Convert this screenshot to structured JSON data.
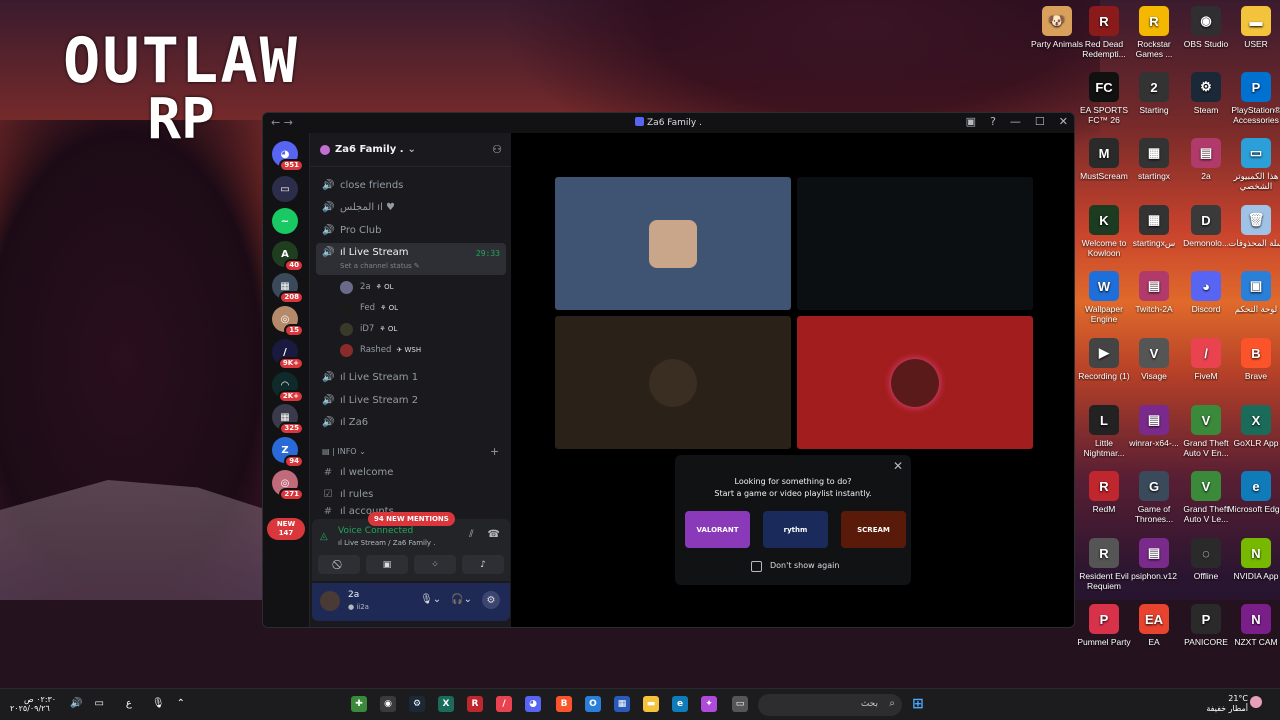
{
  "wallpaper": {
    "logo_line1": "OUTLAW",
    "logo_line2": "RP"
  },
  "desktop_icons": [
    {
      "label": "Party Animals",
      "color": "#d9a05b",
      "glyph": "🐶"
    },
    {
      "label": "Red Dead Redempti...",
      "color": "#8b1b1b",
      "glyph": "R"
    },
    {
      "label": "Rockstar Games ...",
      "color": "#f5b800",
      "glyph": "R"
    },
    {
      "label": "OBS Studio",
      "color": "#302e31",
      "glyph": "◉"
    },
    {
      "label": "USER",
      "color": "#f3c33b",
      "glyph": "▬"
    },
    {
      "label": "EA SPORTS FC™ 26",
      "color": "#111111",
      "glyph": "FC"
    },
    {
      "label": "Starting",
      "color": "#333333",
      "glyph": "2"
    },
    {
      "label": "Steam",
      "color": "#1b2838",
      "glyph": "⚙"
    },
    {
      "label": "PlayStation® Accessories",
      "color": "#0070d1",
      "glyph": "P"
    },
    {
      "label": "MustScream",
      "color": "#2a2a2a",
      "glyph": "M"
    },
    {
      "label": "startingx",
      "color": "#333333",
      "glyph": "▦"
    },
    {
      "label": "2a",
      "color": "#b03a6a",
      "glyph": "▤"
    },
    {
      "label": "هذا الكمبيوتر الشخصي",
      "color": "#2a9fd8",
      "glyph": "▭"
    },
    {
      "label": "Welcome to Kowloon",
      "color": "#1d3b20",
      "glyph": "K"
    },
    {
      "label": "startingxس",
      "color": "#333333",
      "glyph": "▦"
    },
    {
      "label": "Demonolo...",
      "color": "#3a3a3a",
      "glyph": "D"
    },
    {
      "label": "سلة المحذوفات",
      "color": "#9fc3e6",
      "glyph": "🗑"
    },
    {
      "label": "Wallpaper Engine",
      "color": "#1e6fd9",
      "glyph": "W"
    },
    {
      "label": "Twitch-2A",
      "color": "#b03a6a",
      "glyph": "▤"
    },
    {
      "label": "Discord",
      "color": "#5865f2",
      "glyph": "◕"
    },
    {
      "label": "لوحة التحكم",
      "color": "#2a7fd8",
      "glyph": "▣"
    },
    {
      "label": "Recording (1)",
      "color": "#444444",
      "glyph": "▶"
    },
    {
      "label": "Visage",
      "color": "#555555",
      "glyph": "V"
    },
    {
      "label": "FiveM",
      "color": "#e8434f",
      "glyph": "/"
    },
    {
      "label": "Brave",
      "color": "#fb542b",
      "glyph": "B"
    },
    {
      "label": "Little Nightmar...",
      "color": "#222222",
      "glyph": "L"
    },
    {
      "label": "winrar-x64-...",
      "color": "#7a2a8a",
      "glyph": "▤"
    },
    {
      "label": "Grand Theft Auto V En...",
      "color": "#3b8a3b",
      "glyph": "V"
    },
    {
      "label": "GoXLR App",
      "color": "#1a6b5a",
      "glyph": "X"
    },
    {
      "label": "RedM",
      "color": "#c0262d",
      "glyph": "R"
    },
    {
      "label": "Game of Thrones...",
      "color": "#3a4a5a",
      "glyph": "G"
    },
    {
      "label": "Grand Theft Auto V Le...",
      "color": "#3b8a3b",
      "glyph": "V"
    },
    {
      "label": "Microsoft Edge",
      "color": "#0f7bb8",
      "glyph": "e"
    },
    {
      "label": "Resident Evil Requiem",
      "color": "#555555",
      "glyph": "R"
    },
    {
      "label": "psiphon.v12",
      "color": "#7a2a8a",
      "glyph": "▤"
    },
    {
      "label": "Offline",
      "color": "#2a2a2a",
      "glyph": "◌"
    },
    {
      "label": "NVIDIA App",
      "color": "#76b900",
      "glyph": "N"
    },
    {
      "label": "Pummel Party",
      "color": "#d8324a",
      "glyph": "P"
    },
    {
      "label": "EA",
      "color": "#e8432f",
      "glyph": "EA"
    },
    {
      "label": "PANICORE",
      "color": "#2a2a2a",
      "glyph": "P"
    },
    {
      "label": "NZXT CAM",
      "color": "#7a1f8a",
      "glyph": "N"
    }
  ],
  "window": {
    "title": "Za6 Family .",
    "server_name": "Za6 Family ."
  },
  "guilds": [
    {
      "badge": "951",
      "color": "#5865f2",
      "glyph": "◕"
    },
    {
      "badge": "",
      "color": "#2b2d4a",
      "glyph": "▭"
    },
    {
      "badge": "",
      "color": "#18c964",
      "glyph": "~"
    },
    {
      "badge": "40",
      "color": "#1f3d1f",
      "glyph": "A"
    },
    {
      "badge": "208",
      "color": "#3a4a5a",
      "glyph": "▦"
    },
    {
      "badge": "15",
      "color": "#b58a6a",
      "glyph": "◎"
    },
    {
      "badge": "9K+",
      "color": "#1a1a40",
      "glyph": "/"
    },
    {
      "badge": "2K+",
      "color": "#0f2a2a",
      "glyph": "◠"
    },
    {
      "badge": "325",
      "color": "#3a3a4a",
      "glyph": "▦"
    },
    {
      "badge": "94",
      "color": "#2a6ad8",
      "glyph": "Z"
    },
    {
      "badge": "271",
      "color": "#c06a7a",
      "glyph": "◎"
    }
  ],
  "new_pill": {
    "line1": "NEW",
    "line2": "147"
  },
  "channels": [
    {
      "icon": "🔊",
      "name": "close friends"
    },
    {
      "icon": "🔊",
      "name": "المجلس ıl ♥"
    },
    {
      "icon": "🔊",
      "name": "Pro Club"
    }
  ],
  "live_stream": {
    "name": "ıl Live Stream",
    "timer": "29:33",
    "status": "Set a channel status ✎"
  },
  "voice_users": [
    {
      "name": "2a",
      "tag": "OL",
      "color": "#6a6a8a"
    },
    {
      "name": "Fed",
      "tag": "OL",
      "color": "#1a1a1a"
    },
    {
      "name": "iD7",
      "tag": "OL",
      "color": "#3a3a2a"
    },
    {
      "name": "Rashed",
      "tag": "WSH",
      "color": "#8a2a2a"
    }
  ],
  "more_channels": [
    {
      "icon": "🔊",
      "name": "ıl Live Stream 1"
    },
    {
      "icon": "🔊",
      "name": "ıl Live Stream 2"
    },
    {
      "icon": "🔊",
      "name": "ıl Za6"
    }
  ],
  "category": {
    "name": "| INFO ⌄",
    "plus": "+"
  },
  "info_channels": [
    {
      "icon": "#",
      "name": "ıl welcome"
    },
    {
      "icon": "☑",
      "name": "ıl rules"
    },
    {
      "icon": "#",
      "name": "ıl accounts"
    }
  ],
  "mentions_pill": "94 NEW MENTIONS",
  "voice_panel": {
    "title": "Voice Connected",
    "subtitle": "ıl Live Stream / Za6 Family ."
  },
  "user_panel": {
    "name": "2a",
    "status": "ii2a"
  },
  "popup": {
    "line1": "Looking for something to do?",
    "line2": "Start a game or video playlist instantly.",
    "checkbox_label": "Don't show again",
    "activities": [
      {
        "label": "VALORANT",
        "color": "#8a3ab8"
      },
      {
        "label": "rythm",
        "color": "#1a2a5a"
      },
      {
        "label": "SCREAM",
        "color": "#5a1a0a"
      }
    ]
  },
  "video_tiles": [
    {
      "color": "#3f5473",
      "avatar": "#c9a68a"
    },
    {
      "color": "#0c0f11",
      "avatar": "#0c0f11"
    },
    {
      "color": "#2a2118",
      "avatar": "#6a5a45"
    },
    {
      "color": "#a21d1d",
      "avatar": "#5a1a1a"
    }
  ],
  "taskbar": {
    "time": "٠٢:٣٠ ص",
    "date": "٢٠٢٥/٠٩/٢٦",
    "lang": "ع",
    "search_placeholder": "بحث",
    "temp": "21°C",
    "weather": "أمطار خفيفة"
  }
}
